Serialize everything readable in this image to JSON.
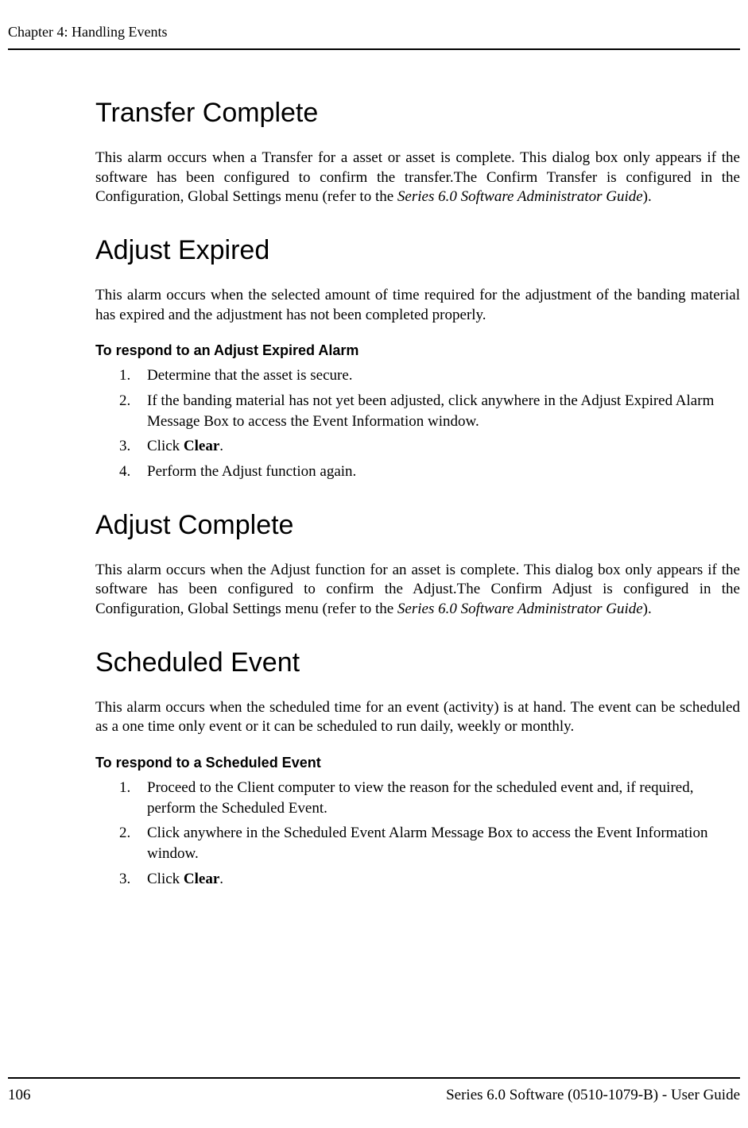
{
  "header": {
    "chapter": "Chapter 4: Handling Events"
  },
  "sections": {
    "s1": {
      "title": "Transfer Complete",
      "para_a": "This alarm occurs when a Transfer for a asset or asset is complete. This dialog box only appears if the software has been configured to confirm the transfer.The Confirm Transfer is configured in the Configuration, Global Settings menu (refer to the ",
      "para_b_italic": "Series 6.0 Software Administrator Guide",
      "para_c": ")."
    },
    "s2": {
      "title": "Adjust Expired",
      "para": "This alarm occurs when the selected amount of time required for the adjustment of the banding material has expired and the adjustment has not been completed properly.",
      "sub": "To respond to an Adjust Expired Alarm",
      "items": {
        "n1": "1.",
        "t1": "Determine that the asset is secure.",
        "n2": "2.",
        "t2": "If the banding material has not yet been adjusted, click anywhere in the Adjust Expired Alarm Message Box to access the Event Information window.",
        "n3": "3.",
        "t3a": "Click ",
        "t3b_bold": "Clear",
        "t3c": ".",
        "n4": "4.",
        "t4": "Perform the Adjust function again."
      }
    },
    "s3": {
      "title": "Adjust Complete",
      "para_a": "This alarm occurs when the Adjust function for an asset is complete. This dialog box only appears if the software has been configured to confirm the Adjust.The Confirm Adjust is configured in the Configuration, Global Settings menu (refer to the ",
      "para_b_italic": "Series 6.0 Software Administrator Guide",
      "para_c": ")."
    },
    "s4": {
      "title": "Scheduled Event",
      "para": "This alarm occurs when the scheduled time for an event (activity) is at hand. The event can be scheduled as a one time only event or it can be scheduled to run daily, weekly or monthly.",
      "sub": "To respond to a Scheduled Event",
      "items": {
        "n1": "1.",
        "t1": "Proceed to the Client computer to view the reason for the scheduled event and, if required, perform the Scheduled Event.",
        "n2": "2.",
        "t2": "Click anywhere in the Scheduled Event Alarm Message Box to access the Event Information window.",
        "n3": "3.",
        "t3a": "Click ",
        "t3b_bold": "Clear",
        "t3c": "."
      }
    }
  },
  "footer": {
    "page_num": "106",
    "right": "Series 6.0 Software (0510-1079-B) - User Guide"
  }
}
